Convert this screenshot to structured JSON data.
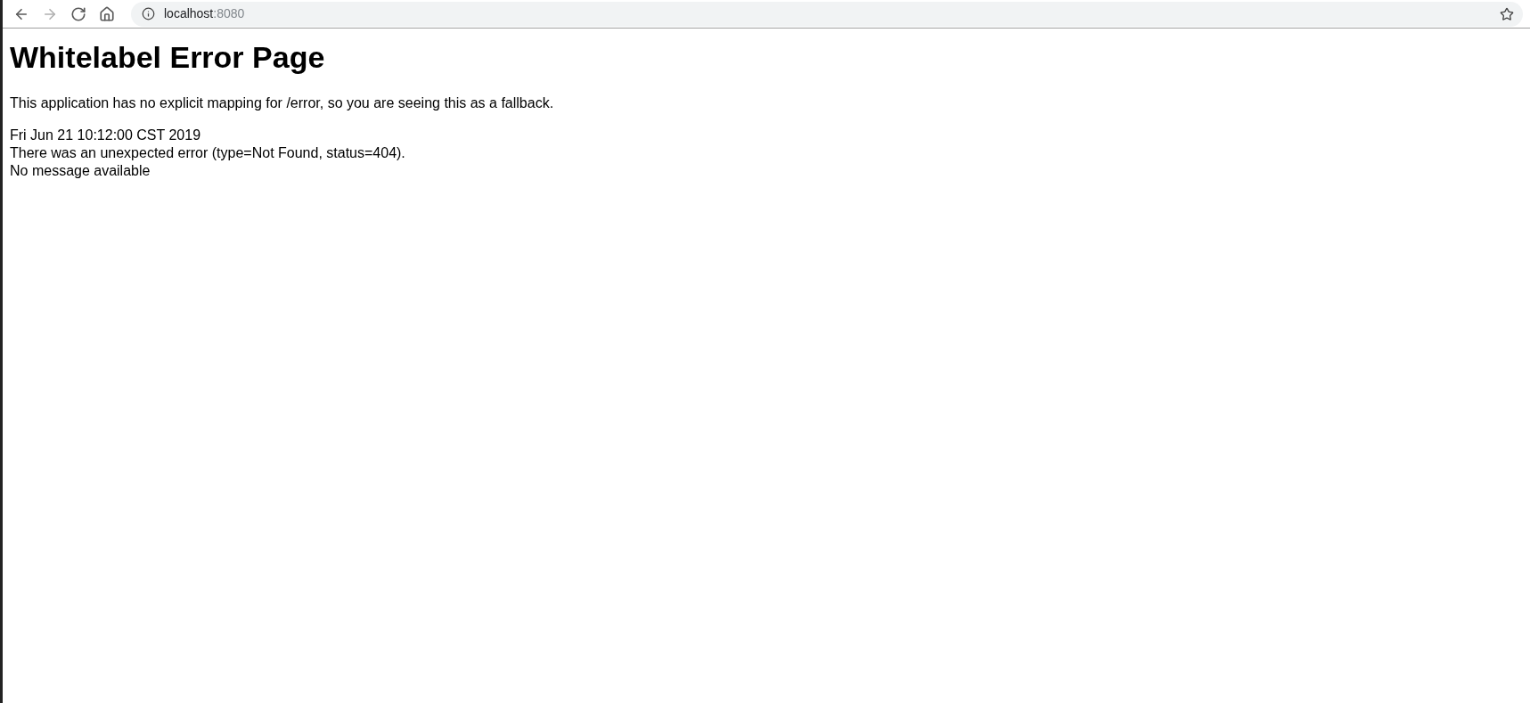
{
  "toolbar": {
    "buttons": [
      {
        "kind": "back",
        "disabled": false
      },
      {
        "kind": "forward",
        "disabled": true
      },
      {
        "kind": "reload",
        "disabled": false
      },
      {
        "kind": "home",
        "disabled": false
      }
    ],
    "address": {
      "host": "localhost",
      "port": ":8080"
    },
    "bookmarked": false
  },
  "page": {
    "title": "Whitelabel Error Page",
    "intro": "This application has no explicit mapping for /error, so you are seeing this as a fallback.",
    "lines": [
      "Fri Jun 21 10:12:00 CST 2019",
      "There was an unexpected error (type=Not Found, status=404).",
      "No message available"
    ]
  }
}
